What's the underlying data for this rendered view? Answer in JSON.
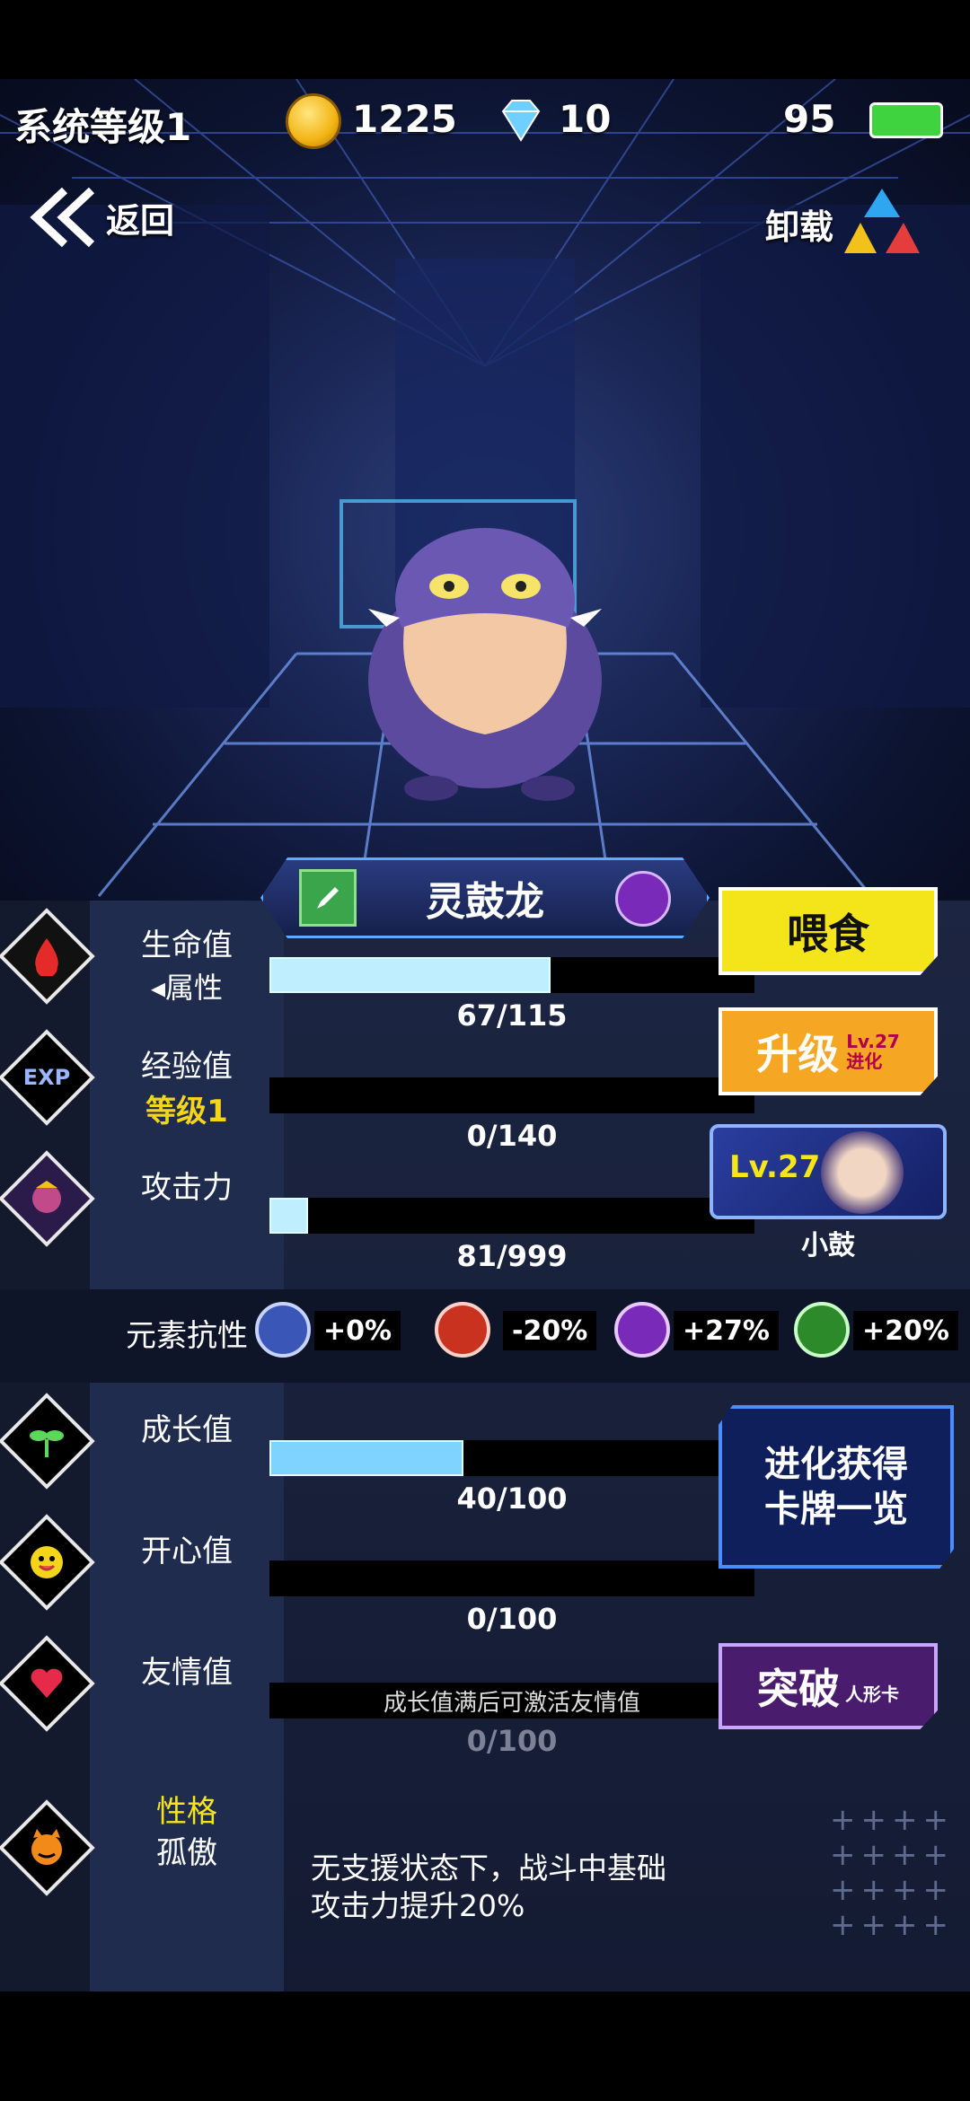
{
  "hud": {
    "system_level": "系统等级1",
    "coins": "1225",
    "diamonds": "10",
    "battery": "95"
  },
  "nav": {
    "back": "返回",
    "unload": "卸载"
  },
  "pet": {
    "name": "灵鼓龙"
  },
  "stats": {
    "hp": {
      "label": "生命值",
      "sub": "属性",
      "value": "67/115",
      "fill": 0.58
    },
    "exp": {
      "label": "经验值",
      "sub": "等级1",
      "value": "0/140",
      "fill": 0.0
    },
    "atk": {
      "label": "攻击力",
      "value": "81/999",
      "fill": 0.08
    },
    "growth": {
      "label": "成长值",
      "value": "40/100",
      "fill": 0.4
    },
    "happy": {
      "label": "开心值",
      "value": "0/100",
      "fill": 0.0
    },
    "friend": {
      "label": "友情值",
      "value": "0/100",
      "bar_text": "成长值满后可激活友情值"
    }
  },
  "resist": {
    "label": "元素抗性",
    "items": [
      {
        "icon": "water-element-icon",
        "value": "+0%",
        "color": "#3a57b8"
      },
      {
        "icon": "fire-element-icon",
        "value": "-20%",
        "color": "#c8321e"
      },
      {
        "icon": "thunder-element-icon",
        "value": "+27%",
        "color": "#7a2ab8"
      },
      {
        "icon": "poison-element-icon",
        "value": "+20%",
        "color": "#2c8a2a"
      }
    ]
  },
  "buttons": {
    "feed": "喂食",
    "upgrade": "升级",
    "upgrade_lv": "Lv.27",
    "upgrade_evolve": "进化",
    "evolve_card_lv": "Lv.27",
    "evolve_card_name": "小鼓",
    "evolution_cards_line1": "进化获得",
    "evolution_cards_line2": "卡牌一览",
    "breakthrough": "突破",
    "breakthrough_sub": "人形卡"
  },
  "personality": {
    "label": "性格",
    "value": "孤傲",
    "desc_line1": "无支援状态下，战斗中基础",
    "desc_line2": "攻击力提升20%"
  },
  "colors": {
    "feed_bg": "#f4e51a",
    "upgrade_bg": "#f5a623",
    "evolution_bg": "#0e1f5c",
    "break_bg": "#4a1c6e",
    "exp_sub": "#f5d51a",
    "personality_label": "#f5e51a"
  }
}
